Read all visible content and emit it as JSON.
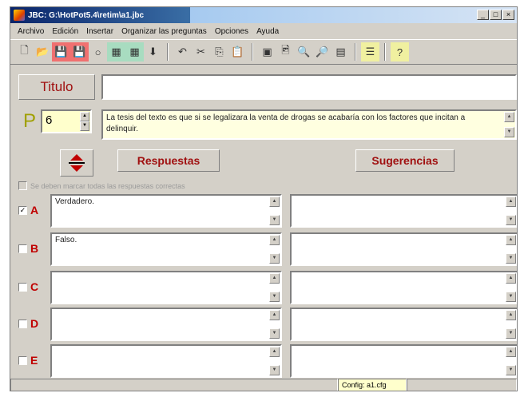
{
  "window": {
    "title": "JBC: G:\\HotPot5.4\\retim\\a1.jbc",
    "controls": {
      "minimize": "_",
      "maximize": "□",
      "close": "×"
    }
  },
  "menu": [
    "Archivo",
    "Edición",
    "Insertar",
    "Organizar las preguntas",
    "Opciones",
    "Ayuda"
  ],
  "toolbar": {
    "groups": [
      [
        {
          "name": "new-file-icon",
          "glyph": "🗋",
          "highlight": ""
        },
        {
          "name": "open-folder-icon",
          "glyph": "📂",
          "highlight": ""
        },
        {
          "name": "save-icon",
          "glyph": "💾",
          "highlight": "red"
        },
        {
          "name": "save-as-icon",
          "glyph": "💾",
          "highlight": "red"
        },
        {
          "name": "open-web-icon",
          "glyph": "○",
          "highlight": ""
        },
        {
          "name": "import-icon",
          "glyph": "▦",
          "highlight": "green"
        },
        {
          "name": "export-icon",
          "glyph": "▦",
          "highlight": "green"
        },
        {
          "name": "down-arrow-icon",
          "glyph": "⬇",
          "highlight": ""
        }
      ],
      [
        {
          "name": "undo-icon",
          "glyph": "↶",
          "highlight": ""
        },
        {
          "name": "cut-icon",
          "glyph": "✂",
          "highlight": ""
        },
        {
          "name": "copy-icon",
          "glyph": "⎘",
          "highlight": ""
        },
        {
          "name": "paste-icon",
          "glyph": "📋",
          "highlight": ""
        }
      ],
      [
        {
          "name": "config-icon",
          "glyph": "▣",
          "highlight": ""
        },
        {
          "name": "web-page-icon",
          "glyph": "🖻",
          "highlight": ""
        },
        {
          "name": "search-icon",
          "glyph": "🔍",
          "highlight": ""
        },
        {
          "name": "find-icon",
          "glyph": "🔎",
          "highlight": ""
        },
        {
          "name": "pdf-icon",
          "glyph": "▤",
          "highlight": ""
        }
      ],
      [
        {
          "name": "options-icon",
          "glyph": "☰",
          "highlight": "yellow"
        }
      ],
      [
        {
          "name": "help-icon",
          "glyph": "?",
          "highlight": "yellow"
        }
      ]
    ]
  },
  "titulo": {
    "label": "Titulo",
    "value": ""
  },
  "pregunta": {
    "letter": "P",
    "number": "6",
    "text": "La tesis del texto es que si se legalizara la venta de drogas se acabaría con los factores que incitan a delinquir."
  },
  "buttons": {
    "respuestas": "Respuestas",
    "sugerencias": "Sugerencias"
  },
  "all_correct": {
    "label": "Se deben marcar todas las respuestas correctas",
    "checked": false
  },
  "answers": [
    {
      "letter": "A",
      "checked": true,
      "text": "Verdadero.",
      "feedback": ""
    },
    {
      "letter": "B",
      "checked": false,
      "text": "Falso.",
      "feedback": ""
    },
    {
      "letter": "C",
      "checked": false,
      "text": "",
      "feedback": ""
    },
    {
      "letter": "D",
      "checked": false,
      "text": "",
      "feedback": ""
    },
    {
      "letter": "E",
      "checked": false,
      "text": "",
      "feedback": ""
    }
  ],
  "status": {
    "config_file": "Config: a1.cfg"
  },
  "colors": {
    "accent_red": "#c00000",
    "label_red": "#a01010",
    "question_bg": "#ffffe0",
    "title_bar": "#0a246a",
    "status_highlight": "#ffffcc"
  }
}
